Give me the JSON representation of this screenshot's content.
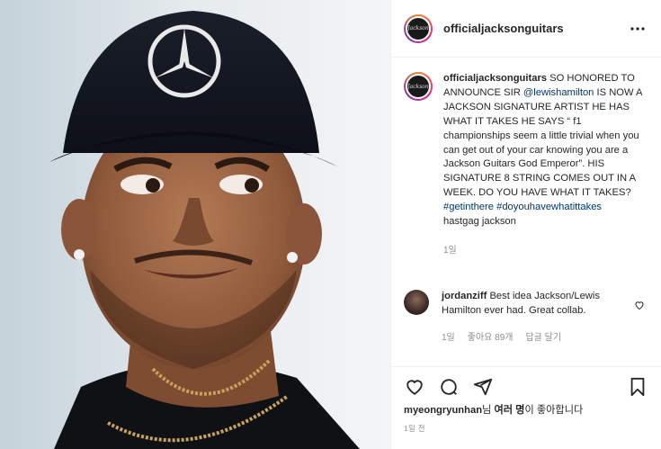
{
  "post": {
    "username": "officialjacksonguitars",
    "avatar_icon": "jackson-logo-avatar",
    "avatar_text": "Jackson"
  },
  "caption": {
    "username": "officialjacksonguitars",
    "text_1": " SO HONORED TO ANNOUNCE SIR ",
    "mention": "@lewishamilton",
    "text_2": " IS NOW A JACKSON SIGNATURE ARTIST HE HAS WHAT IT TAKES HE SAYS “ f1 championships seem a little trivial when you can get out of your car knowing you are a Jackson Guitars God Emperor”. HIS SIGNATURE 8 STRING COMES OUT IN A WEEK. DO YOU HAVE WHAT IT TAKES?",
    "hashtag_1": "#getinthere",
    "hashtag_2": "#doyouhavewhatittakes",
    "text_3": "hastgag jackson",
    "time": "1일"
  },
  "comment": {
    "username": "jordanziff",
    "text": " Best idea Jackson/Lewis Hamilton ever had. Great collab.",
    "time": "1일",
    "likes": "좋아요 89개",
    "reply": "답글 달기"
  },
  "likes": {
    "user": "myeongryunhan",
    "text_1": "님 ",
    "bold": "여러 명",
    "text_2": "이 좋아합니다"
  },
  "post_time": "1일 전",
  "colors": {
    "link": "#00376b",
    "muted": "#8e8e8e",
    "text": "#262626"
  }
}
